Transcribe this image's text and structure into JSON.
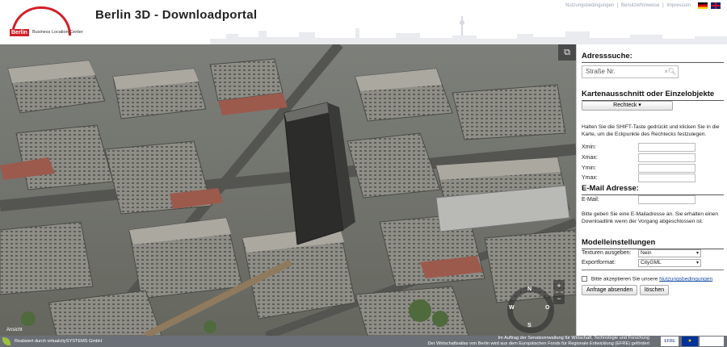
{
  "header": {
    "logo_brand": "Berlin",
    "logo_sub": "Business Location Center",
    "title": "Berlin 3D - Downloadportal",
    "links": [
      "Nutzungsbedingungen",
      "Benutzerhinweise",
      "Impressum"
    ],
    "separator": "|"
  },
  "map": {
    "credit": "Ansicht",
    "popout_icon": "external-window-icon",
    "compass_letters": [
      "N",
      "O",
      "S",
      "W"
    ],
    "zoom_in": "+",
    "zoom_out": "−",
    "colors": {
      "ground": "#6d6f6a",
      "roof": "#a9a79f",
      "shadow": "#3d3e3b"
    }
  },
  "panel": {
    "address": {
      "heading": "Adresssuche:",
      "placeholder": "Straße Nr.",
      "clear": "×",
      "search_icon": "magnifier-icon"
    },
    "cut": {
      "heading": "Kartenausschnitt oder Einzelobjekte",
      "mode_button": "Rechteck ▾",
      "info": "Halten Sie die SHIFT-Taste gedrückt und klicken Sie in die Karte, um die Eckpunkte des Rechtecks festzulegen.",
      "fields": [
        {
          "label": "Xmin:",
          "value": ""
        },
        {
          "label": "Xmax:",
          "value": ""
        },
        {
          "label": "Ymin:",
          "value": ""
        },
        {
          "label": "Ymax:",
          "value": ""
        }
      ]
    },
    "email": {
      "heading": "E-Mail Adresse:",
      "label": "E-Mail:",
      "value": "",
      "info": "Bitte geben Sie eine E-Mailadresse an. Sie erhalten einen Downloadlink wenn der Vorgang abgeschlossen ist."
    },
    "model": {
      "heading": "Modelleinstellungen",
      "textures_label": "Texturen ausgeben:",
      "textures_value": "Nein",
      "format_label": "Exportformat:",
      "format_value": "CityGML"
    },
    "agree_text": "Bitte akzeptieren Sie unsere",
    "agree_link": "Nutzungsbedingungen",
    "submit": "Anfrage absenden",
    "clear_button": "löschen"
  },
  "footer": {
    "left": "Realisiert durch virtualcitySYSTEMS GmbH",
    "right_line1": "Im Auftrag der Senatsverwaltung für Wirtschaft, Technologie und Forschung",
    "right_line2": "Der Wirtschaftsatlas von Berlin wird aus dem Europäischen Fonds für Regionale Entwicklung (EFRE) gefördert",
    "efre": "EFRE",
    "eu": "★"
  }
}
